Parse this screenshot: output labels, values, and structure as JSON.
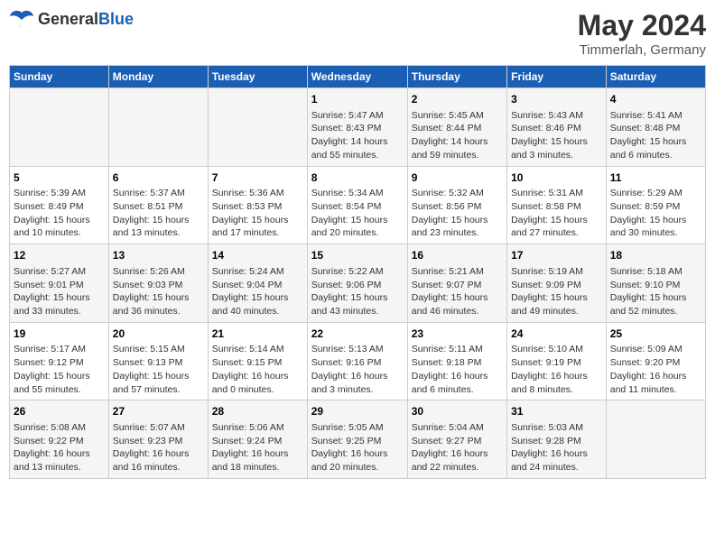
{
  "header": {
    "logo_general": "General",
    "logo_blue": "Blue",
    "month_year": "May 2024",
    "location": "Timmerlah, Germany"
  },
  "weekdays": [
    "Sunday",
    "Monday",
    "Tuesday",
    "Wednesday",
    "Thursday",
    "Friday",
    "Saturday"
  ],
  "weeks": [
    [
      {
        "day": "",
        "info": ""
      },
      {
        "day": "",
        "info": ""
      },
      {
        "day": "",
        "info": ""
      },
      {
        "day": "1",
        "info": "Sunrise: 5:47 AM\nSunset: 8:43 PM\nDaylight: 14 hours\nand 55 minutes."
      },
      {
        "day": "2",
        "info": "Sunrise: 5:45 AM\nSunset: 8:44 PM\nDaylight: 14 hours\nand 59 minutes."
      },
      {
        "day": "3",
        "info": "Sunrise: 5:43 AM\nSunset: 8:46 PM\nDaylight: 15 hours\nand 3 minutes."
      },
      {
        "day": "4",
        "info": "Sunrise: 5:41 AM\nSunset: 8:48 PM\nDaylight: 15 hours\nand 6 minutes."
      }
    ],
    [
      {
        "day": "5",
        "info": "Sunrise: 5:39 AM\nSunset: 8:49 PM\nDaylight: 15 hours\nand 10 minutes."
      },
      {
        "day": "6",
        "info": "Sunrise: 5:37 AM\nSunset: 8:51 PM\nDaylight: 15 hours\nand 13 minutes."
      },
      {
        "day": "7",
        "info": "Sunrise: 5:36 AM\nSunset: 8:53 PM\nDaylight: 15 hours\nand 17 minutes."
      },
      {
        "day": "8",
        "info": "Sunrise: 5:34 AM\nSunset: 8:54 PM\nDaylight: 15 hours\nand 20 minutes."
      },
      {
        "day": "9",
        "info": "Sunrise: 5:32 AM\nSunset: 8:56 PM\nDaylight: 15 hours\nand 23 minutes."
      },
      {
        "day": "10",
        "info": "Sunrise: 5:31 AM\nSunset: 8:58 PM\nDaylight: 15 hours\nand 27 minutes."
      },
      {
        "day": "11",
        "info": "Sunrise: 5:29 AM\nSunset: 8:59 PM\nDaylight: 15 hours\nand 30 minutes."
      }
    ],
    [
      {
        "day": "12",
        "info": "Sunrise: 5:27 AM\nSunset: 9:01 PM\nDaylight: 15 hours\nand 33 minutes."
      },
      {
        "day": "13",
        "info": "Sunrise: 5:26 AM\nSunset: 9:03 PM\nDaylight: 15 hours\nand 36 minutes."
      },
      {
        "day": "14",
        "info": "Sunrise: 5:24 AM\nSunset: 9:04 PM\nDaylight: 15 hours\nand 40 minutes."
      },
      {
        "day": "15",
        "info": "Sunrise: 5:22 AM\nSunset: 9:06 PM\nDaylight: 15 hours\nand 43 minutes."
      },
      {
        "day": "16",
        "info": "Sunrise: 5:21 AM\nSunset: 9:07 PM\nDaylight: 15 hours\nand 46 minutes."
      },
      {
        "day": "17",
        "info": "Sunrise: 5:19 AM\nSunset: 9:09 PM\nDaylight: 15 hours\nand 49 minutes."
      },
      {
        "day": "18",
        "info": "Sunrise: 5:18 AM\nSunset: 9:10 PM\nDaylight: 15 hours\nand 52 minutes."
      }
    ],
    [
      {
        "day": "19",
        "info": "Sunrise: 5:17 AM\nSunset: 9:12 PM\nDaylight: 15 hours\nand 55 minutes."
      },
      {
        "day": "20",
        "info": "Sunrise: 5:15 AM\nSunset: 9:13 PM\nDaylight: 15 hours\nand 57 minutes."
      },
      {
        "day": "21",
        "info": "Sunrise: 5:14 AM\nSunset: 9:15 PM\nDaylight: 16 hours\nand 0 minutes."
      },
      {
        "day": "22",
        "info": "Sunrise: 5:13 AM\nSunset: 9:16 PM\nDaylight: 16 hours\nand 3 minutes."
      },
      {
        "day": "23",
        "info": "Sunrise: 5:11 AM\nSunset: 9:18 PM\nDaylight: 16 hours\nand 6 minutes."
      },
      {
        "day": "24",
        "info": "Sunrise: 5:10 AM\nSunset: 9:19 PM\nDaylight: 16 hours\nand 8 minutes."
      },
      {
        "day": "25",
        "info": "Sunrise: 5:09 AM\nSunset: 9:20 PM\nDaylight: 16 hours\nand 11 minutes."
      }
    ],
    [
      {
        "day": "26",
        "info": "Sunrise: 5:08 AM\nSunset: 9:22 PM\nDaylight: 16 hours\nand 13 minutes."
      },
      {
        "day": "27",
        "info": "Sunrise: 5:07 AM\nSunset: 9:23 PM\nDaylight: 16 hours\nand 16 minutes."
      },
      {
        "day": "28",
        "info": "Sunrise: 5:06 AM\nSunset: 9:24 PM\nDaylight: 16 hours\nand 18 minutes."
      },
      {
        "day": "29",
        "info": "Sunrise: 5:05 AM\nSunset: 9:25 PM\nDaylight: 16 hours\nand 20 minutes."
      },
      {
        "day": "30",
        "info": "Sunrise: 5:04 AM\nSunset: 9:27 PM\nDaylight: 16 hours\nand 22 minutes."
      },
      {
        "day": "31",
        "info": "Sunrise: 5:03 AM\nSunset: 9:28 PM\nDaylight: 16 hours\nand 24 minutes."
      },
      {
        "day": "",
        "info": ""
      }
    ]
  ]
}
